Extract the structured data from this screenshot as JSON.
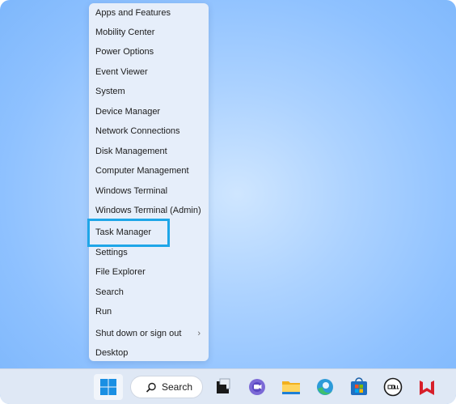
{
  "menu": {
    "items": [
      {
        "label": "Apps and Features"
      },
      {
        "label": "Mobility Center"
      },
      {
        "label": "Power Options"
      },
      {
        "label": "Event Viewer"
      },
      {
        "label": "System"
      },
      {
        "label": "Device Manager"
      },
      {
        "label": "Network Connections"
      },
      {
        "label": "Disk Management"
      },
      {
        "label": "Computer Management"
      },
      {
        "label": "Windows Terminal"
      },
      {
        "label": "Windows Terminal (Admin)"
      },
      {
        "label": "Task Manager"
      },
      {
        "label": "Settings"
      },
      {
        "label": "File Explorer"
      },
      {
        "label": "Search"
      },
      {
        "label": "Run"
      },
      {
        "label": "Shut down or sign out",
        "submenu_icon": "chevron-right-icon"
      },
      {
        "label": "Desktop"
      }
    ],
    "highlighted_item": "Task Manager",
    "highlight_color": "#1ea6e8"
  },
  "taskbar": {
    "search_label": "Search",
    "icons": [
      "windows-start-icon",
      "search-icon",
      "task-view-icon",
      "teams-chat-icon",
      "file-explorer-icon",
      "edge-browser-icon",
      "microsoft-store-icon",
      "dell-icon",
      "mcafee-icon"
    ]
  }
}
